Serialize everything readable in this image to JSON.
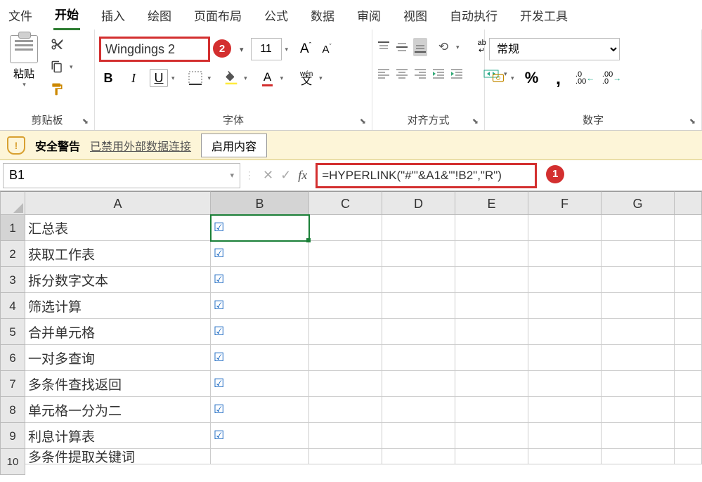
{
  "tabs": [
    "文件",
    "开始",
    "插入",
    "绘图",
    "页面布局",
    "公式",
    "数据",
    "审阅",
    "视图",
    "自动执行",
    "开发工具"
  ],
  "active_tab": 1,
  "ribbon": {
    "clipboard": {
      "paste": "粘贴",
      "label": "剪贴板"
    },
    "font": {
      "name": "Wingdings 2",
      "size": "11",
      "label": "字体",
      "bold": "B",
      "italic": "I",
      "underline": "U",
      "wen": "wén",
      "wenchar": "文"
    },
    "align": {
      "label": "对齐方式"
    },
    "number": {
      "format": "常规",
      "label": "数字"
    }
  },
  "annotations": {
    "step1": "1",
    "step2": "2"
  },
  "security": {
    "title": "安全警告",
    "link": "已禁用外部数据连接",
    "button": "启用内容"
  },
  "namebox": "B1",
  "formula": "=HYPERLINK(\"#'\"&A1&\"'!B2\",\"R\")",
  "cols": [
    "A",
    "B",
    "C",
    "D",
    "E",
    "F",
    "G"
  ],
  "rows": [
    {
      "n": "1",
      "a": "汇总表",
      "b": "☑"
    },
    {
      "n": "2",
      "a": "获取工作表",
      "b": "☑"
    },
    {
      "n": "3",
      "a": "拆分数字文本",
      "b": "☑"
    },
    {
      "n": "4",
      "a": "筛选计算",
      "b": "☑"
    },
    {
      "n": "5",
      "a": "合并单元格",
      "b": "☑"
    },
    {
      "n": "6",
      "a": "一对多查询",
      "b": "☑"
    },
    {
      "n": "7",
      "a": "多条件查找返回",
      "b": "☑"
    },
    {
      "n": "8",
      "a": "单元格一分为二",
      "b": "☑"
    },
    {
      "n": "9",
      "a": "利息计算表",
      "b": "☑"
    },
    {
      "n": "10",
      "a": "多条件提取关键词",
      "b": ""
    }
  ]
}
